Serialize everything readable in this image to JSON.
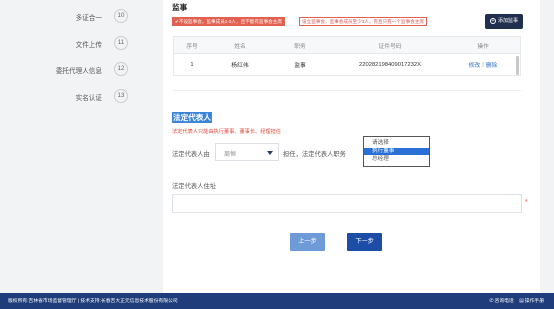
{
  "steps": [
    {
      "label": "多证合一",
      "num": "10"
    },
    {
      "label": "文件上传",
      "num": "11"
    },
    {
      "label": "委托代理人信息",
      "num": "12"
    },
    {
      "label": "实名认证",
      "num": "13"
    }
  ],
  "supervisor": {
    "title": "监事",
    "warning_fill": "✔不设监事会，监事成员1-2人，且不能有监事会主席",
    "warning_outline": "设立监事会，监事会成员至少3人，有且只有一个监事会主席",
    "add_button": "添加监事",
    "table": {
      "headers": [
        "序号",
        "姓名",
        "职务",
        "证件号码",
        "操作"
      ],
      "rows": [
        {
          "index": "1",
          "name": "杨红伟",
          "role": "监事",
          "id": "220282198409017232X",
          "edit": "修改",
          "sep": "|",
          "delete": "删除"
        }
      ]
    }
  },
  "legal_rep": {
    "title": "法定代表人",
    "hint": "法定代表人只能由执行董事、董事长、经理担任",
    "from_label": "法定代表人由",
    "from_value": "周恒",
    "role_label": "担任，法定代表人职务",
    "role_options": [
      {
        "label": "请选择",
        "active": false
      },
      {
        "label": "执行董事",
        "active": true
      },
      {
        "label": "总经理",
        "active": false
      }
    ],
    "address_label": "法定代表人住址",
    "address_value": "",
    "required_mark": "*"
  },
  "buttons": {
    "prev": "上一步",
    "next": "下一步"
  },
  "footer": {
    "copyright": "版权所有:吉林省市场监督管理厅 | 技术支持:长春吉大正元信息技术股份有限公司",
    "consult": "咨询电话",
    "manual": "操作手册"
  },
  "colors": {
    "accent": "#1c4ea7",
    "footer": "#1e3d7a",
    "warning": "#e2604f",
    "dark_button": "#1f2f4d"
  }
}
